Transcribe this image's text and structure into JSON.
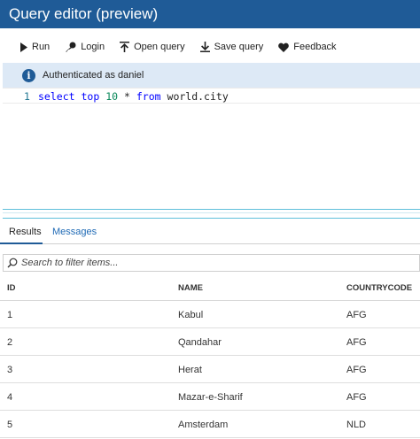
{
  "window": {
    "title": "Query editor (preview)"
  },
  "toolbar": {
    "run_label": "Run",
    "login_label": "Login",
    "open_query_label": "Open query",
    "save_query_label": "Save query",
    "feedback_label": "Feedback"
  },
  "info": {
    "icon": "info-icon",
    "message": "Authenticated as daniel"
  },
  "editor": {
    "line_number": "1",
    "tokens": {
      "select": "select",
      "top": "top",
      "ten": "10",
      "star": "*",
      "from": "from",
      "table": "world.city"
    }
  },
  "results": {
    "tabs": [
      "Results",
      "Messages"
    ],
    "filter_placeholder": "Search to filter items...",
    "columns": [
      "ID",
      "NAME",
      "COUNTRYCODE"
    ],
    "rows": [
      [
        "1",
        "Kabul",
        "AFG"
      ],
      [
        "2",
        "Qandahar",
        "AFG"
      ],
      [
        "3",
        "Herat",
        "AFG"
      ],
      [
        "4",
        "Mazar-e-Sharif",
        "AFG"
      ],
      [
        "5",
        "Amsterdam",
        "NLD"
      ]
    ]
  },
  "colors": {
    "titlebar": "#1f5b97",
    "info_bg": "#dde9f6",
    "keyword": "#0000ff",
    "number": "#09885a",
    "link": "#1f6ab5"
  }
}
